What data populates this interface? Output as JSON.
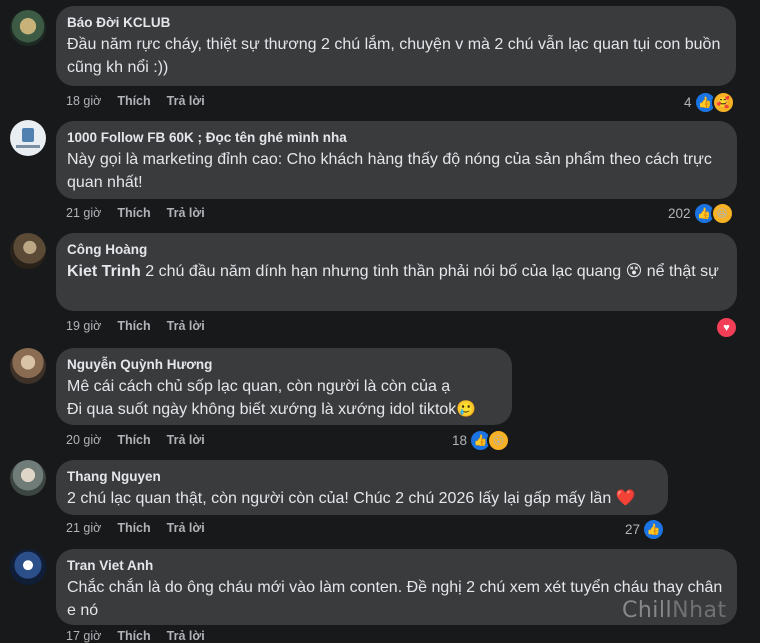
{
  "comments": [
    {
      "author": "Báo Đời KCLUB",
      "text": "Đầu năm rực cháy, thiệt sự thương 2 chú lắm, chuyện v mà 2 chú vẫn lạc quan tụi con buồn cũng kh nổi :))",
      "time": "18 giờ",
      "like": "Thích",
      "reply": "Trả lời",
      "reaction_count": "4",
      "reactions": [
        "like-icon",
        "care-icon"
      ]
    },
    {
      "author": "1000 Follow FB 60K ; Đọc tên ghé mình nha",
      "text": "Này gọi là marketing đỉnh cao: Cho khách hàng thấy độ nóng của sản phẩm theo cách trực quan nhất!",
      "time": "21 giờ",
      "like": "Thích",
      "reply": "Trả lời",
      "reaction_count": "202",
      "reactions": [
        "like-icon",
        "haha-icon"
      ]
    },
    {
      "author": "Công Hoàng",
      "mention": "Kiet Trinh",
      "text": " 2 chú đầu năm dính hạn nhưng tinh thần phải nói bố của lạc quang 😵 nể thật sự",
      "time": "19 giờ",
      "like": "Thích",
      "reply": "Trả lời",
      "reaction_count": "",
      "reactions": [
        "love-icon"
      ]
    },
    {
      "author": "Nguyễn Quỳnh Hương",
      "text_line1": "Mê cái cách chủ sốp lạc quan, còn người là còn của ạ",
      "text_line2": "Đi qua suốt ngày không biết xướng là xướng idol tiktok🥲",
      "time": "20 giờ",
      "like": "Thích",
      "reply": "Trả lời",
      "reaction_count": "18",
      "reactions": [
        "like-icon",
        "wow-icon"
      ]
    },
    {
      "author": "Thang Nguyen",
      "text": "2 chú lạc quan thật, còn người còn của! Chúc 2 chú 2026 lấy lại gấp mấy lần ❤️",
      "time": "21 giờ",
      "like": "Thích",
      "reply": "Trả lời",
      "reaction_count": "27",
      "reactions": [
        "like-icon"
      ]
    },
    {
      "author": "Tran Viet Anh",
      "text": "Chắc chắn là do ông cháu mới vào làm conten. Đề nghị 2 chú xem xét tuyển cháu thay chân e nó",
      "time": "17 giờ",
      "like": "Thích",
      "reply": "Trả lời"
    }
  ],
  "watermark": {
    "part1": "Chill",
    "part2": "Nhat"
  },
  "colors": {
    "background": "#18191a",
    "bubble": "#3a3b3c",
    "like": "#1b74e4",
    "love": "#f33e58",
    "haha": "#f7b125"
  }
}
